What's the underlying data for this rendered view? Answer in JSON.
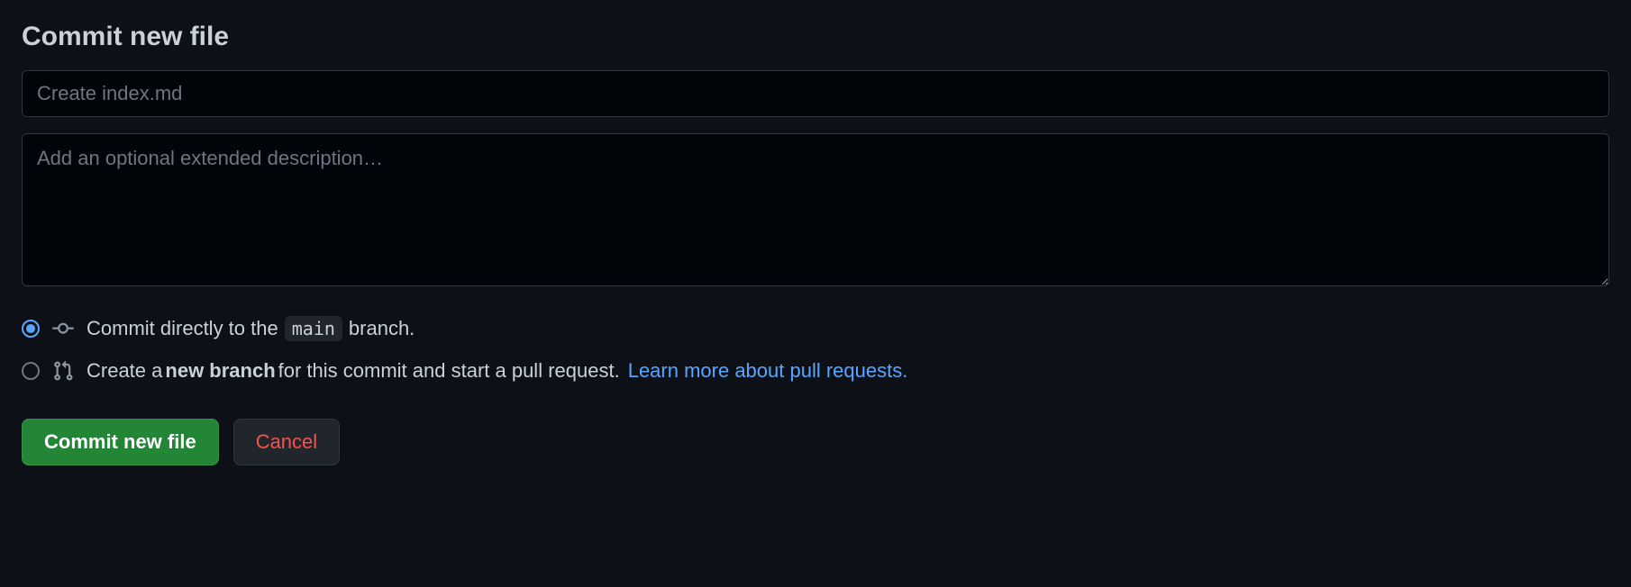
{
  "heading": "Commit new file",
  "summary": {
    "placeholder": "Create index.md",
    "value": ""
  },
  "description": {
    "placeholder": "Add an optional extended description…",
    "value": ""
  },
  "options": {
    "direct": {
      "selected": true,
      "text_before": "Commit directly to the",
      "branch": "main",
      "text_after": "branch."
    },
    "new_branch": {
      "selected": false,
      "text_before": "Create a",
      "bold_text": "new branch",
      "text_after": "for this commit and start a pull request.",
      "link_text": "Learn more about pull requests."
    }
  },
  "buttons": {
    "commit": "Commit new file",
    "cancel": "Cancel"
  }
}
